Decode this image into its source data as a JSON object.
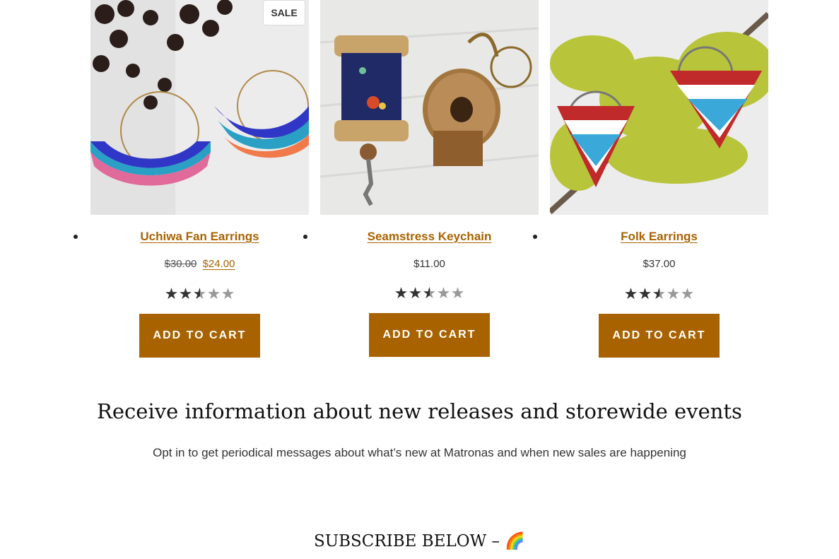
{
  "products": [
    {
      "title": "Uchiwa Fan Earrings",
      "old_price": "$30.00",
      "price": "$24.00",
      "on_sale": true,
      "sale_label": "SALE",
      "rating": 2.5,
      "button": "ADD TO CART"
    },
    {
      "title": "Seamstress Keychain",
      "price": "$11.00",
      "rating": 2.5,
      "button": "ADD TO CART"
    },
    {
      "title": "Folk Earrings",
      "price": "$37.00",
      "rating": 2.5,
      "button": "ADD TO CART"
    }
  ],
  "newsletter": {
    "heading": "Receive information about new releases and storewide events",
    "subheading": "Opt in to get periodical messages about what’s new at Matronas and when new sales are happening",
    "subscribe": "SUBSCRIBE BELOW – 🌈"
  },
  "colors": {
    "accent": "#a86300",
    "star_filled": "#333333",
    "star_empty": "#999999"
  }
}
